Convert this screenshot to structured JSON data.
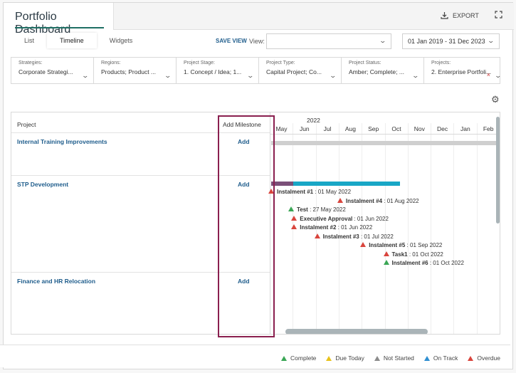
{
  "header": {
    "title": "Portfolio Dashboard",
    "export_label": "EXPORT",
    "export_icon": "download-icon",
    "expand_icon": "expand-icon"
  },
  "toolbar": {
    "tabs": [
      {
        "label": "List",
        "active": false
      },
      {
        "label": "Timeline",
        "active": true
      },
      {
        "label": "Widgets",
        "active": false
      }
    ],
    "save_view_label": "SAVE VIEW",
    "view_label": "View:",
    "view_value": "",
    "date_range": "01 Jan 2019 - 31 Dec 2023"
  },
  "filters": [
    {
      "label": "Strategies:",
      "value": "Corporate Strategi..."
    },
    {
      "label": "Regions:",
      "value": "Products; Product ..."
    },
    {
      "label": "Project Stage:",
      "value": "1. Concept / Idea; 1..."
    },
    {
      "label": "Project Type:",
      "value": "Capital Project; Co..."
    },
    {
      "label": "Project Status:",
      "value": "Amber; Complete; ..."
    },
    {
      "label": "Projects:",
      "value": "2. Enterprise Portfoli..."
    }
  ],
  "grid": {
    "project_header": "Project",
    "add_header": "Add Milestone",
    "year": "2022",
    "months": [
      "May",
      "Jun",
      "Jul",
      "Aug",
      "Sep",
      "Oct",
      "Nov",
      "Dec",
      "Jan",
      "Feb"
    ],
    "rows": [
      {
        "project": "Internal Training Improvements",
        "add": "Add"
      },
      {
        "project": "STP Development",
        "add": "Add"
      },
      {
        "project": "Finance and HR Relocation",
        "add": "Add"
      }
    ],
    "milestones": [
      {
        "name": "Instalment #1",
        "date": "01 May 2022",
        "status": "Overdue"
      },
      {
        "name": "Instalment #4",
        "date": "01 Aug 2022",
        "status": "Overdue"
      },
      {
        "name": "Test",
        "date": "27 May 2022",
        "status": "Complete"
      },
      {
        "name": "Executive Approval",
        "date": "01 Jun 2022",
        "status": "Overdue"
      },
      {
        "name": "Instalment #2",
        "date": "01 Jun 2022",
        "status": "Overdue"
      },
      {
        "name": "Instalment #3",
        "date": "01 Jul 2022",
        "status": "Overdue"
      },
      {
        "name": "Instalment #5",
        "date": "01 Sep 2022",
        "status": "Overdue"
      },
      {
        "name": "Task1",
        "date": "01 Oct 2022",
        "status": "Overdue"
      },
      {
        "name": "Instalment #6",
        "date": "01 Oct 2022",
        "status": "Complete"
      }
    ]
  },
  "legend": [
    {
      "label": "Complete",
      "color": "#3aa655"
    },
    {
      "label": "Due Today",
      "color": "#e8c21c"
    },
    {
      "label": "Not Started",
      "color": "#8c8c8c"
    },
    {
      "label": "On Track",
      "color": "#2f8fd1"
    },
    {
      "label": "Overdue",
      "color": "#d9453d"
    }
  ],
  "colors": {
    "accent": "#1f6f64",
    "link": "#1f5d8c",
    "highlight": "#8a1f4f",
    "bar_grey": "#cfcfcf",
    "bar_purple": "#7b4f78",
    "bar_teal": "#19a7c6"
  }
}
